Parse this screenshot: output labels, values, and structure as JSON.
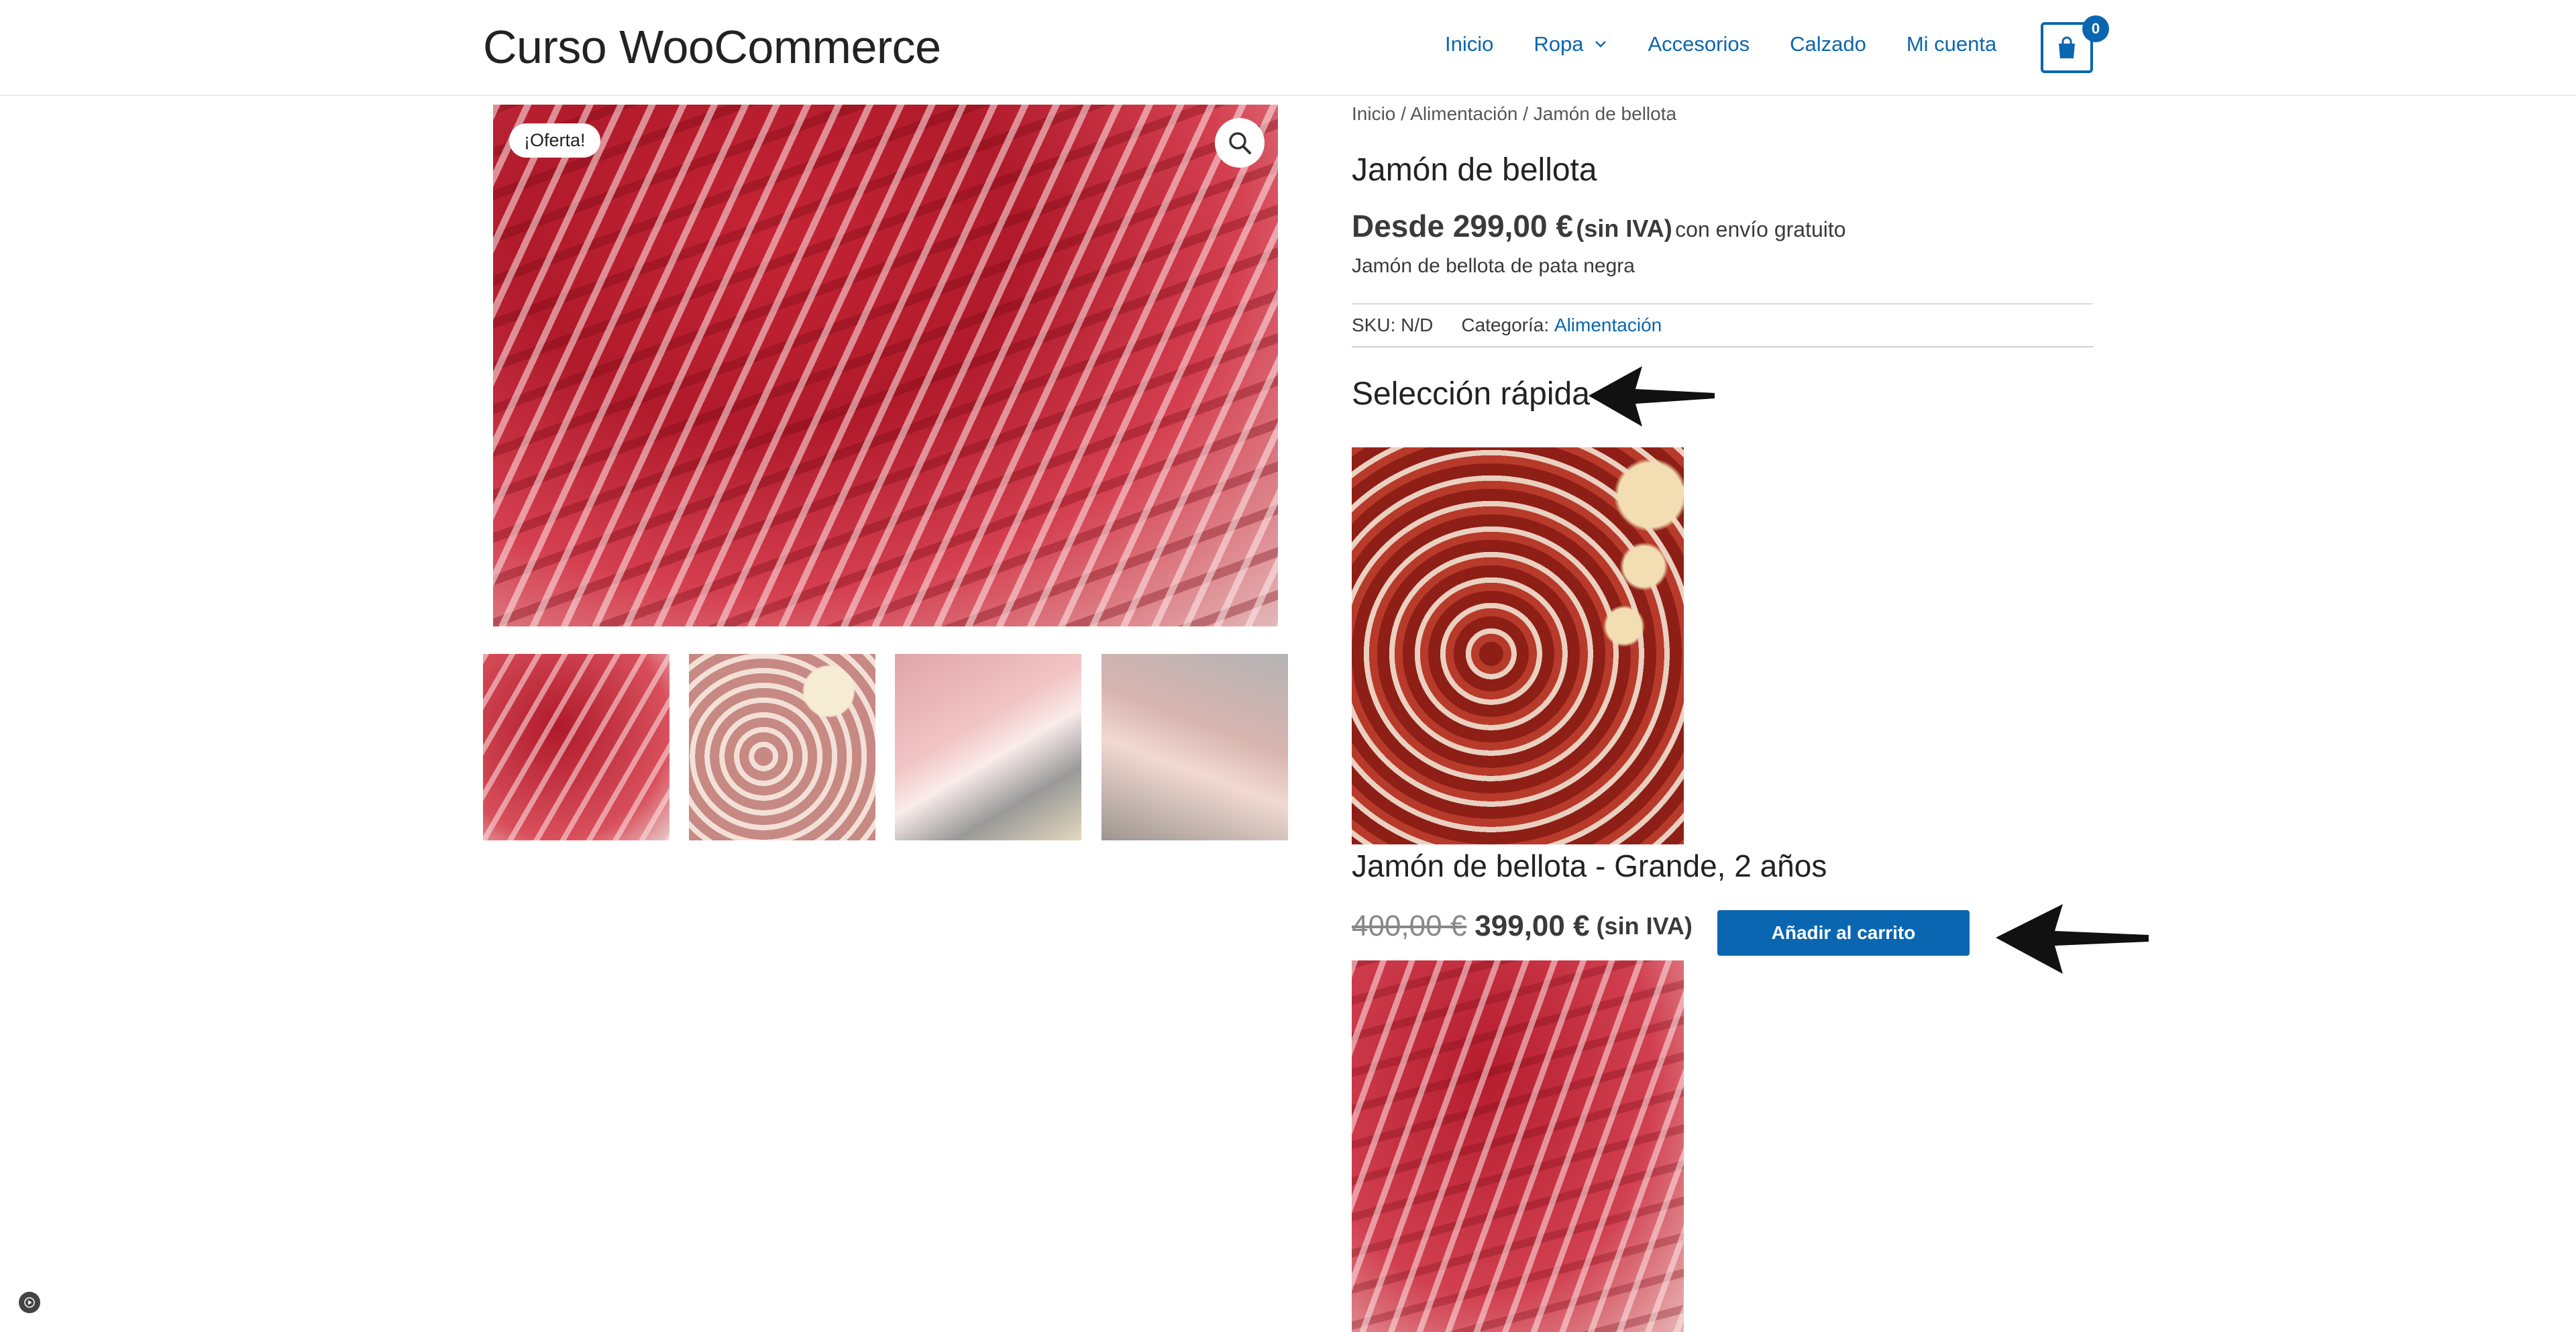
{
  "header": {
    "site_title": "Curso WooCommerce",
    "nav": [
      {
        "label": "Inicio"
      },
      {
        "label": "Ropa",
        "has_dropdown": true
      },
      {
        "label": "Accesorios"
      },
      {
        "label": "Calzado"
      },
      {
        "label": "Mi cuenta"
      }
    ],
    "cart_count": "0"
  },
  "gallery": {
    "sale_badge": "¡Oferta!",
    "thumbnails": [
      "thumbnail-1",
      "thumbnail-2",
      "thumbnail-3",
      "thumbnail-4"
    ]
  },
  "product": {
    "breadcrumb": "Inicio / Alimentación / Jamón de bellota",
    "title": "Jamón de bellota",
    "price_prefix": "Desde 299,00 €",
    "price_tax": "(sin IVA)",
    "price_shipping": "con envío gratuito",
    "short_description": "Jamón de bellota de pata negra",
    "sku_label": "SKU:",
    "sku_value": "N/D",
    "category_label": "Categoría:",
    "category_value": "Alimentación"
  },
  "quick_selection": {
    "title": "Selección rápida",
    "variation": {
      "name": "Jamón de bellota - Grande, 2 años",
      "old_price": "400,00 €",
      "new_price": "399,00 €",
      "tax": "(sin IVA)",
      "add_to_cart_label": "Añadir al carrito"
    }
  },
  "colors": {
    "accent": "#0a66b0",
    "text": "#3a3a3a"
  }
}
